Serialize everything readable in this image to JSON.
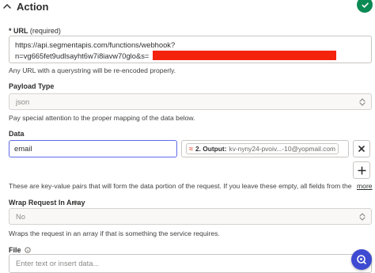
{
  "section": {
    "title": "Action",
    "status_color": "#0b8a53"
  },
  "url_field": {
    "label": "* URL",
    "required_text": "(required)",
    "value_line1": "https://api.segmentapis.com/functions/webhook?",
    "value_line2": "n=vg665fet9udlsayht6w7i8iavw70glo&s=",
    "help": "Any URL with a querystring will be re-encoded properly."
  },
  "payload_type": {
    "label": "Payload Type",
    "value": "json",
    "help": "Pay special attention to the proper mapping of the data below."
  },
  "data_field": {
    "label": "Data",
    "key_value": "email",
    "mapped_step": "2. Output:",
    "mapped_value": "kv-nyny24-pvoiv...-10@yopmail.com",
    "help": "These are key-value pairs that will form the data portion of the request. If you leave these empty, all fields from the previous step...",
    "more_link": "more"
  },
  "wrap_request": {
    "label": "Wrap Request In Array",
    "value": "No",
    "help": "Wraps the request in an array if that is something the service requires."
  },
  "file_field": {
    "label": "File",
    "placeholder": "Enter text or insert data..."
  },
  "icons": {
    "collapse": "chevron-up-icon",
    "status": "check-circle-icon",
    "select": "select-arrows-icon",
    "remove": "close-icon",
    "add": "plus-icon",
    "file_meta": "info-icon",
    "fab": "assistant-icon"
  },
  "colors": {
    "accent": "#5f6be8",
    "fab": "#3d4ad1",
    "redaction": "#f4230d",
    "mapping_icon": "#e8563f"
  }
}
